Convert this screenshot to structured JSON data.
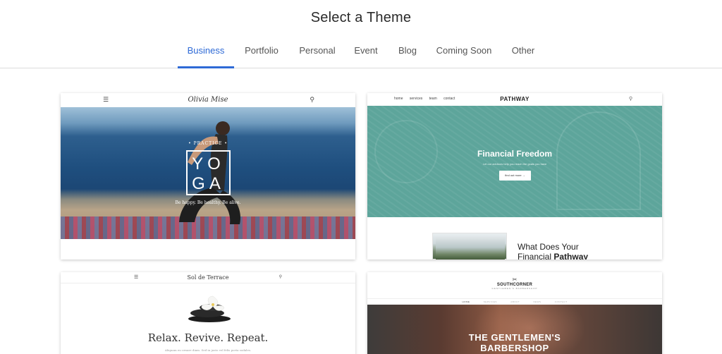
{
  "header": {
    "title": "Select a Theme"
  },
  "tabs": [
    {
      "label": "Business",
      "active": true
    },
    {
      "label": "Portfolio",
      "active": false
    },
    {
      "label": "Personal",
      "active": false
    },
    {
      "label": "Event",
      "active": false
    },
    {
      "label": "Blog",
      "active": false
    },
    {
      "label": "Coming Soon",
      "active": false
    },
    {
      "label": "Other",
      "active": false
    }
  ],
  "colors": {
    "accent": "#2e6ad6",
    "teal": "#5da59b"
  },
  "themes": [
    {
      "logo": "Olivia Mise",
      "menu_icon": "menu-icon",
      "search_icon": "search-icon",
      "overline": "• PRACTICE •",
      "title_line1": "YO",
      "title_line2": "GA",
      "tagline": "Be happy. Be healthy. Be alive."
    },
    {
      "nav": [
        "home",
        "services",
        "team",
        "contact"
      ],
      "logo": "PATHWAY",
      "headline": "Financial Freedom",
      "subtext": "Let our advisors help you reach the goals you have",
      "cta": "find out more →",
      "section_title_line1": "What Does Your",
      "section_title_line2_plain": "Financial ",
      "section_title_line2_bold": "Pathway"
    },
    {
      "logo": "Sol de Terrace",
      "headline": "Relax. Revive. Repeat.",
      "subtext": "Aliquam eu ornare diam. Sed in justo vel felis porta sodales."
    },
    {
      "brand_name": "SOUTHCORNER",
      "brand_tag": "GENTLEMEN'S BARBERSHOP",
      "nav": [
        "HOME",
        "SERVICES",
        "ABOUT",
        "NEWS",
        "CONTACT"
      ],
      "headline_line1": "THE GENTLEMEN'S",
      "headline_line2": "BARBERSHOP"
    }
  ]
}
